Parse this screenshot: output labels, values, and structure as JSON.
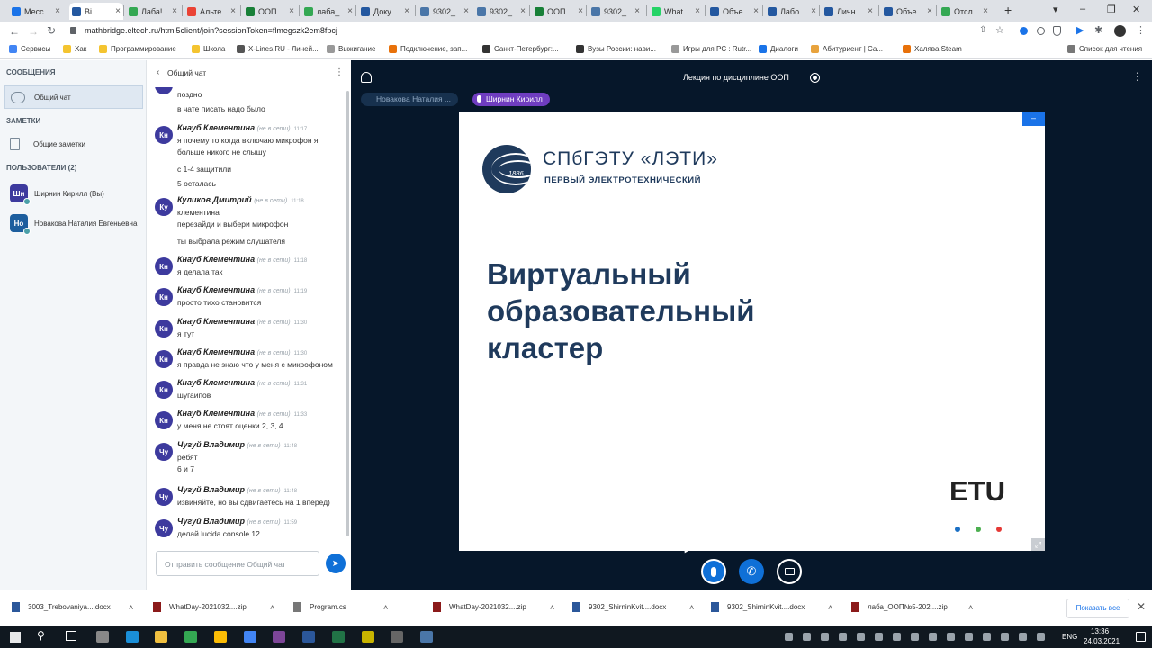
{
  "browser": {
    "tabs": [
      {
        "label": "Месс",
        "color": "#1a73e8"
      },
      {
        "label": "Bi",
        "color": "#2458a0"
      },
      {
        "label": "Лаба!",
        "color": "#34a853"
      },
      {
        "label": "Альте",
        "color": "#ea4335"
      },
      {
        "label": "ООП",
        "color": "#188038"
      },
      {
        "label": "лаба_",
        "color": "#34a853"
      },
      {
        "label": "Доку",
        "color": "#2458a0"
      },
      {
        "label": "9302_",
        "color": "#4a76a8"
      },
      {
        "label": "9302_",
        "color": "#4a76a8"
      },
      {
        "label": "ООП",
        "color": "#188038"
      },
      {
        "label": "9302_",
        "color": "#4a76a8"
      },
      {
        "label": "What",
        "color": "#25d366"
      },
      {
        "label": "Объе",
        "color": "#2458a0"
      },
      {
        "label": "Лабо",
        "color": "#2458a0"
      },
      {
        "label": "Личн",
        "color": "#2458a0"
      },
      {
        "label": "Объе",
        "color": "#2458a0"
      },
      {
        "label": "Отсл",
        "color": "#34a853"
      }
    ],
    "new_tab": "+",
    "url": "mathbridge.eltech.ru/html5client/join?sessionToken=flmegszk2em8fpcj",
    "bookmarks": [
      {
        "label": "Сервисы",
        "color": "#4285f4"
      },
      {
        "label": "Хак",
        "color": "#f4c430"
      },
      {
        "label": "Программирование",
        "color": "#f4c430"
      },
      {
        "label": "Школа",
        "color": "#f4c430"
      },
      {
        "label": "X-Lines.RU - Линей...",
        "color": "#555555"
      },
      {
        "label": "Выжигание",
        "color": "#999999"
      },
      {
        "label": "Подключение, зап...",
        "color": "#e8710a"
      },
      {
        "label": "Санкт-Петербург:...",
        "color": "#333333"
      },
      {
        "label": "Вузы России: нави...",
        "color": "#333333"
      },
      {
        "label": "Игры для PC : Rutr...",
        "color": "#999999"
      },
      {
        "label": "Диалоги",
        "color": "#1a73e8"
      },
      {
        "label": "Абитуриент | Са...",
        "color": "#e8a33d"
      },
      {
        "label": "Халява Steam",
        "color": "#e8710a"
      }
    ],
    "reading_list": "Список для чтения"
  },
  "userlist": {
    "messages_header": "СООБЩЕНИЯ",
    "public_chat": "Общий чат",
    "notes_header": "ЗАМЕТКИ",
    "shared_notes": "Общие заметки",
    "users_header": "ПОЛЬЗОВАТЕЛИ (2)",
    "users": [
      {
        "initials": "Ши",
        "name": "Ширнин Кирилл (Вы)",
        "color": "#3d3a9e"
      },
      {
        "initials": "Но",
        "name": "Новакова Наталия Евгеньевна",
        "color": "#1d5e9e"
      }
    ]
  },
  "chat": {
    "title": "Общий чат",
    "first_lines": [
      "поздно",
      "в чате писать надо было"
    ],
    "messages": [
      {
        "initials": "Кн",
        "name": "Кнауб Клементина",
        "status": "(не в сети)",
        "time": "11:17",
        "lines": [
          "я почему то когда включаю микрофон я",
          "больше никого не слышу",
          "с 1-4 защитили",
          "5 осталась"
        ]
      },
      {
        "initials": "Ку",
        "name": "Куликов Дмитрий",
        "status": "(не в сети)",
        "time": "11:18",
        "lines": [
          "клементина",
          "перезайди и выбери микрофон",
          "ты выбрала режим слушателя"
        ]
      },
      {
        "initials": "Кн",
        "name": "Кнауб Клементина",
        "status": "(не в сети)",
        "time": "11:18",
        "lines": [
          "я делала так"
        ]
      },
      {
        "initials": "Кн",
        "name": "Кнауб Клементина",
        "status": "(не в сети)",
        "time": "11:19",
        "lines": [
          "просто тихо становится"
        ]
      },
      {
        "initials": "Кн",
        "name": "Кнауб Клементина",
        "status": "(не в сети)",
        "time": "11:30",
        "lines": [
          "я тут"
        ]
      },
      {
        "initials": "Кн",
        "name": "Кнауб Клементина",
        "status": "(не в сети)",
        "time": "11:30",
        "lines": [
          "я правда не знаю что у меня с микрофоном"
        ]
      },
      {
        "initials": "Кн",
        "name": "Кнауб Клементина",
        "status": "(не в сети)",
        "time": "11:31",
        "lines": [
          "шугаипов"
        ]
      },
      {
        "initials": "Кн",
        "name": "Кнауб Клементина",
        "status": "(не в сети)",
        "time": "11:33",
        "lines": [
          "у меня не стоят оценки 2, 3, 4"
        ]
      },
      {
        "initials": "Чу",
        "name": "Чугуй Владимир",
        "status": "(не в сети)",
        "time": "11:48",
        "lines": [
          "ребят",
          "6 и 7"
        ]
      },
      {
        "initials": "Чу",
        "name": "Чугуй Владимир",
        "status": "(не в сети)",
        "time": "11:48",
        "lines": [
          "извиняйте, но вы сдвигаетесь на 1 вперед)"
        ]
      },
      {
        "initials": "Чу",
        "name": "Чугуй Владимир",
        "status": "(не в сети)",
        "time": "11:59",
        "lines": [
          "делай lucida console 12"
        ]
      }
    ],
    "input_placeholder": "Отправить сообщение Общий чат"
  },
  "presentation": {
    "meeting_title": "Лекция по дисциплине ООП",
    "talkers": [
      "Новакова Наталия ...",
      "Ширнин Кирилл"
    ],
    "slide": {
      "logo_title": "СПбГЭТУ «ЛЭТИ»",
      "logo_subtitle": "ПЕРВЫЙ ЭЛЕКТРОТЕХНИЧЕСКИЙ",
      "logo_year": "1886",
      "heading_lines": [
        "Виртуальный",
        "образовательный",
        "кластер"
      ],
      "etu_mark": "ETU"
    }
  },
  "downloads": {
    "items": [
      {
        "name": "3003_Trebovaniya....docx",
        "color": "#2b579a"
      },
      {
        "name": "WhatDay-2021032....zip",
        "color": "#8b1a1a"
      },
      {
        "name": "Program.cs",
        "color": "#777777"
      },
      {
        "name": "WhatDay-2021032....zip",
        "color": "#8b1a1a"
      },
      {
        "name": "9302_ShirninKvit....docx",
        "color": "#2b579a"
      },
      {
        "name": "9302_ShirninKvit....docx",
        "color": "#2b579a"
      },
      {
        "name": "лаба_ООП№5-202....zip",
        "color": "#8b1a1a"
      }
    ],
    "show_all": "Показать все"
  },
  "taskbar": {
    "lang": "ENG",
    "time": "13:36",
    "date": "24.03.2021"
  }
}
